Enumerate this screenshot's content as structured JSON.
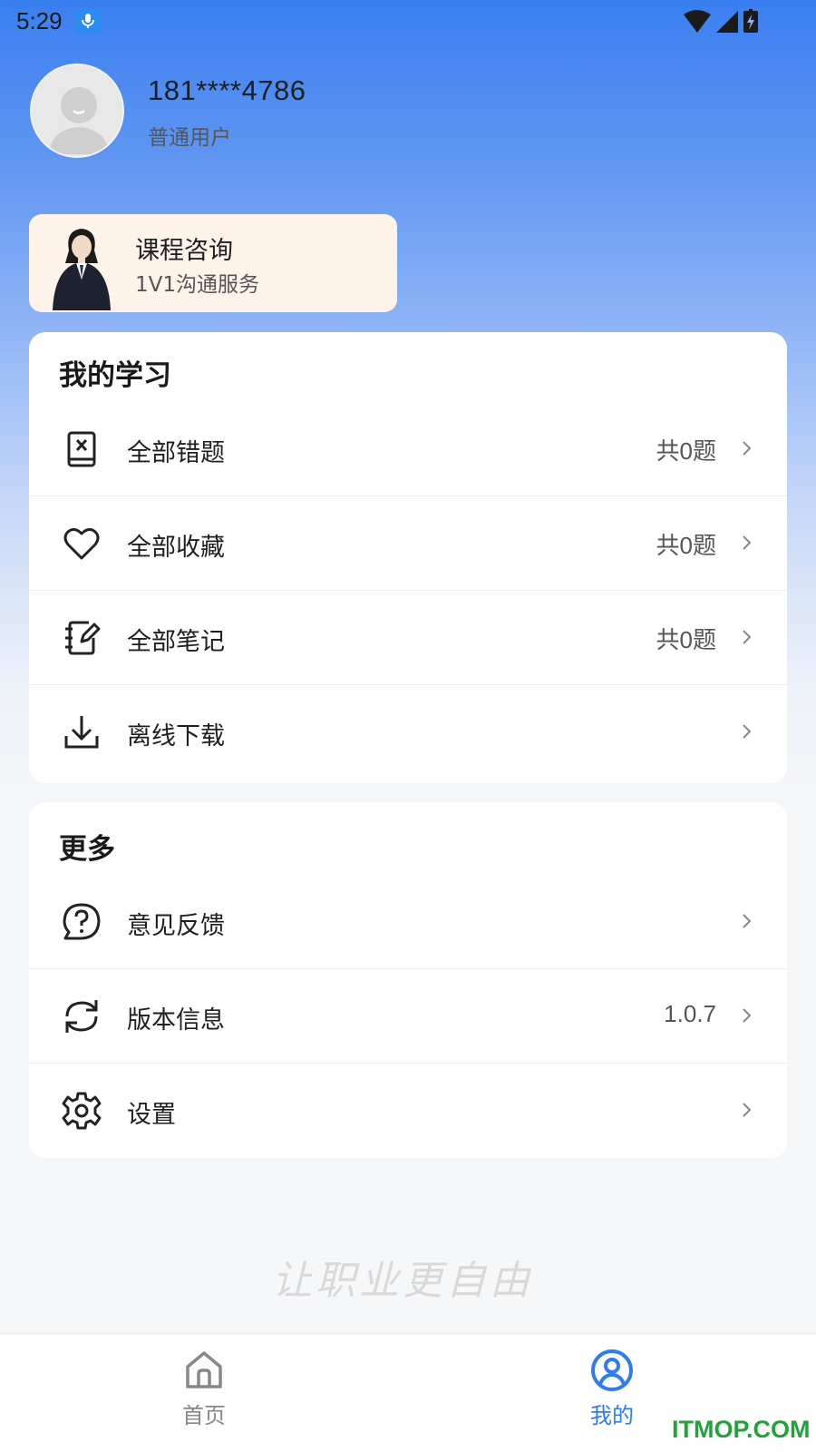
{
  "status_bar": {
    "time": "5:29",
    "icons": [
      "mic-icon",
      "wifi-icon",
      "signal-icon",
      "battery-charging-icon"
    ]
  },
  "profile": {
    "phone": "181****4786",
    "user_type": "普通用户"
  },
  "consult_card": {
    "title": "课程咨询",
    "subtitle": "1V1沟通服务"
  },
  "my_study": {
    "title": "我的学习",
    "items": [
      {
        "label": "全部错题",
        "value": "共0题",
        "icon": "wrong-question-book-icon"
      },
      {
        "label": "全部收藏",
        "value": "共0题",
        "icon": "heart-icon"
      },
      {
        "label": "全部笔记",
        "value": "共0题",
        "icon": "notebook-edit-icon"
      },
      {
        "label": "离线下载",
        "value": "",
        "icon": "download-icon"
      }
    ]
  },
  "more": {
    "title": "更多",
    "items": [
      {
        "label": "意见反馈",
        "value": "",
        "icon": "feedback-question-icon"
      },
      {
        "label": "版本信息",
        "value": "1.0.7",
        "icon": "refresh-icon"
      },
      {
        "label": "设置",
        "value": "",
        "icon": "gear-icon"
      }
    ]
  },
  "slogan": "让职业更自由",
  "bottom_nav": {
    "items": [
      {
        "label": "首页",
        "icon": "home-icon",
        "active": false
      },
      {
        "label": "我的",
        "icon": "user-circle-icon",
        "active": true
      }
    ]
  },
  "watermark": "ITMOP.COM",
  "colors": {
    "accent": "#2f7bef",
    "header_gradient_top": "#3a7ff0",
    "consult_card_bg": "#fdf3e9",
    "page_bg": "#f6f7f9",
    "watermark_green": "#22a33a"
  }
}
